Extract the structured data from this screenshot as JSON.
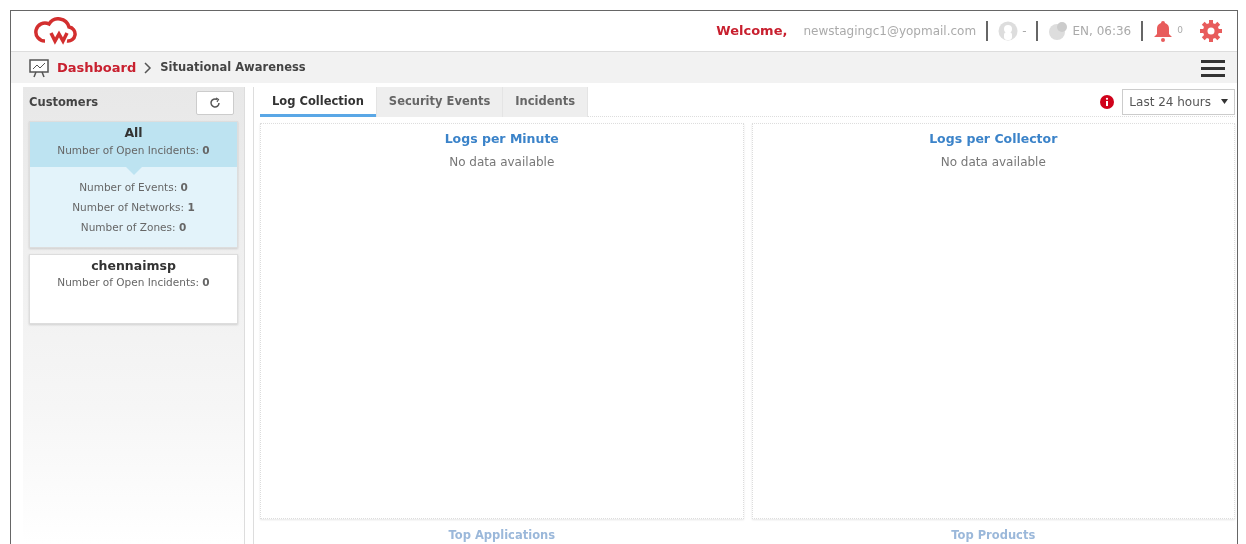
{
  "header": {
    "welcome": "Welcome,",
    "email": "newstagingc1@yopmail.com",
    "user": "-",
    "locale_time": "EN, 06:36",
    "notifications": "0"
  },
  "breadcrumb": [
    {
      "label": "Dashboard",
      "link": true
    },
    {
      "label": "Situational Awareness",
      "link": false
    }
  ],
  "sidebar": {
    "title": "Customers",
    "customers": [
      {
        "name": "All",
        "open_incidents": "Number of Open Incidents: **0**",
        "selected": true,
        "details": [
          "Number of Events: **0**",
          "Number of Networks: **1**",
          "Number of Zones: **0**"
        ]
      },
      {
        "name": "chennaimsp",
        "open_incidents": "Number of Open Incidents: **0**",
        "selected": false
      }
    ]
  },
  "tabs": [
    {
      "label": "Log Collection",
      "selected": true
    },
    {
      "label": "Security Events",
      "selected": false
    },
    {
      "label": "Incidents",
      "selected": false
    }
  ],
  "time_range": {
    "value": "Last 24 hours"
  },
  "panels": [
    {
      "title": "Logs per Minute",
      "message": "No data available"
    },
    {
      "title": "Logs per Collector",
      "message": "No data available"
    }
  ],
  "lower_panels": [
    {
      "title": "Top Applications"
    },
    {
      "title": "Top Products"
    }
  ]
}
